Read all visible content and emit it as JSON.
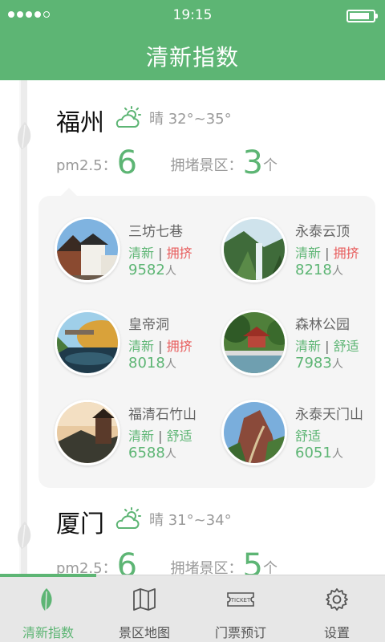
{
  "status_bar": {
    "time": "19:15",
    "signal_bars": 4,
    "signal_total": 5
  },
  "header": {
    "title": "清新指数"
  },
  "colors": {
    "brand": "#5db574",
    "crowded": "#e85d5d",
    "tab_bg": "#e7e7e7"
  },
  "cities": [
    {
      "name": "福州",
      "weather_icon": "partly-sunny-icon",
      "weather": "晴 32°~35°",
      "pm_label": "pm2.5：",
      "pm_value": "6",
      "congested_label": "拥堵景区：",
      "congested_value": "3",
      "congested_unit": "个",
      "spots": [
        {
          "name": "三坊七巷",
          "status": [
            "清新",
            "拥挤"
          ],
          "count": "9582",
          "unit": "人"
        },
        {
          "name": "永泰云顶",
          "status": [
            "清新",
            "拥挤"
          ],
          "count": "8218",
          "unit": "人"
        },
        {
          "name": "皇帝洞",
          "status": [
            "清新",
            "拥挤"
          ],
          "count": "8018",
          "unit": "人"
        },
        {
          "name": "森林公园",
          "status": [
            "清新",
            "舒适"
          ],
          "count": "7983",
          "unit": "人"
        },
        {
          "name": "福清石竹山",
          "status": [
            "清新",
            "舒适"
          ],
          "count": "6588",
          "unit": "人"
        },
        {
          "name": "永泰天门山",
          "status": [
            "舒适"
          ],
          "count": "6051",
          "unit": "人"
        }
      ]
    },
    {
      "name": "厦门",
      "weather_icon": "partly-sunny-icon",
      "weather": "晴 31°~34°",
      "pm_label": "pm2.5：",
      "pm_value": "6",
      "congested_label": "拥堵景区：",
      "congested_value": "5",
      "congested_unit": "个"
    }
  ],
  "tabs": [
    {
      "label": "清新指数",
      "icon": "leaf-icon",
      "active": true
    },
    {
      "label": "景区地图",
      "icon": "map-icon",
      "active": false
    },
    {
      "label": "门票预订",
      "icon": "ticket-icon",
      "active": false,
      "icon_text": "TICKET"
    },
    {
      "label": "设置",
      "icon": "gear-icon",
      "active": false
    }
  ]
}
